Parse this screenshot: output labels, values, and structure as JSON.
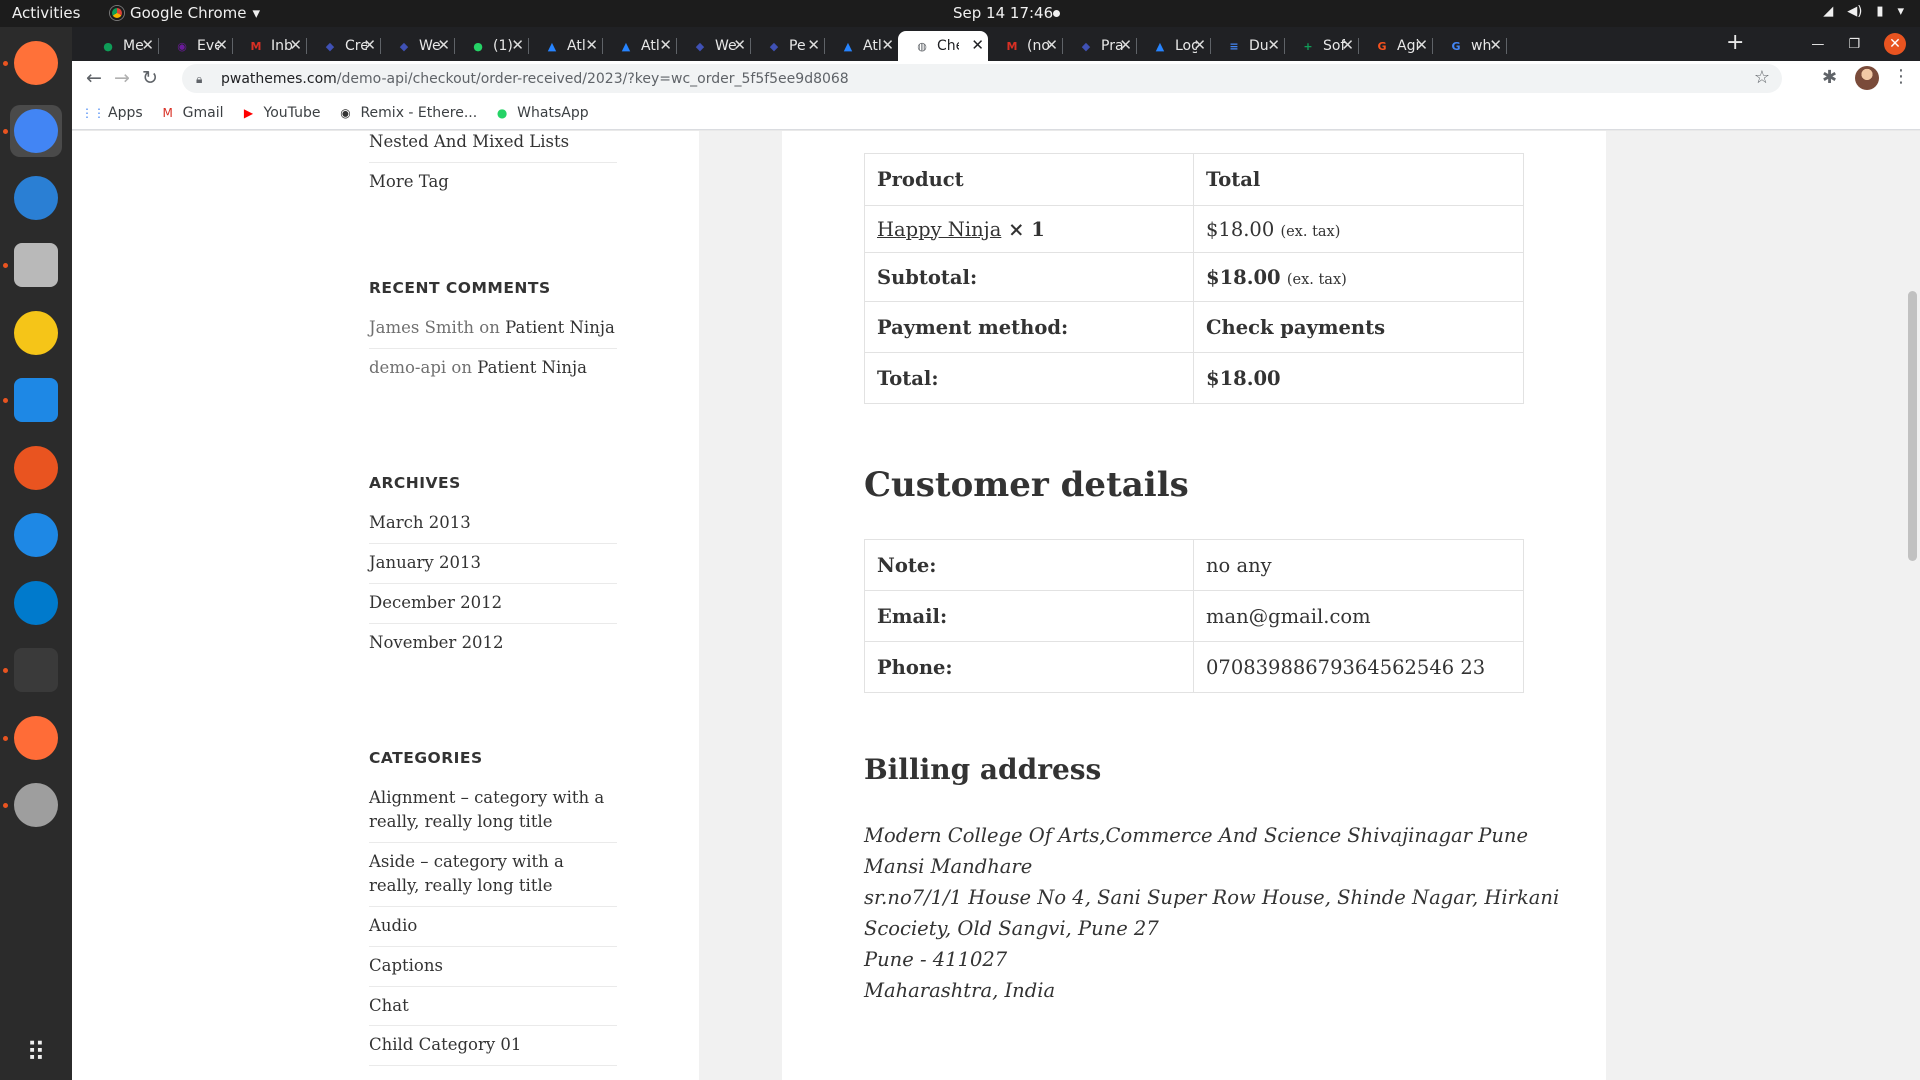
{
  "topbar": {
    "activities": "Activities",
    "app_name": "Google Chrome",
    "clock": "Sep 14  17:46"
  },
  "dock": {
    "items": [
      {
        "name": "firefox-icon",
        "color": "#ff7139"
      },
      {
        "name": "chrome-icon",
        "color": "#4285f4"
      },
      {
        "name": "thunderbird-icon",
        "color": "#2a7fd4"
      },
      {
        "name": "files-icon",
        "color": "#b9b9b9"
      },
      {
        "name": "rhythmbox-icon",
        "color": "#f5c518"
      },
      {
        "name": "writer-icon",
        "color": "#1e88e5"
      },
      {
        "name": "software-center-icon",
        "color": "#e95420"
      },
      {
        "name": "help-icon",
        "color": "#1e88e5"
      },
      {
        "name": "vscode-icon",
        "color": "#007acc"
      },
      {
        "name": "terminal-icon",
        "color": "#3a3a3a"
      },
      {
        "name": "postman-icon",
        "color": "#ff6c37"
      },
      {
        "name": "magnifier-icon",
        "color": "#9e9e9e"
      }
    ]
  },
  "tabs": [
    {
      "title": "Me",
      "fav": "#0f9d58",
      "glyph": "●"
    },
    {
      "title": "Eve",
      "fav": "#6a1b9a",
      "glyph": "◉"
    },
    {
      "title": "Inb",
      "fav": "#d93025",
      "glyph": "M"
    },
    {
      "title": "Cre",
      "fav": "#3f51b5",
      "glyph": "◆"
    },
    {
      "title": "We",
      "fav": "#3f51b5",
      "glyph": "◆"
    },
    {
      "title": "(1)",
      "fav": "#25d366",
      "glyph": "●"
    },
    {
      "title": "Atl",
      "fav": "#2684ff",
      "glyph": "▲"
    },
    {
      "title": "Atl",
      "fav": "#2684ff",
      "glyph": "▲"
    },
    {
      "title": "We",
      "fav": "#3f51b5",
      "glyph": "◆"
    },
    {
      "title": "Pe",
      "fav": "#3f51b5",
      "glyph": "◆"
    },
    {
      "title": "Atl",
      "fav": "#2684ff",
      "glyph": "▲"
    },
    {
      "title": "Che",
      "fav": "#5f6368",
      "glyph": "◍",
      "active": true
    },
    {
      "title": "(no",
      "fav": "#d93025",
      "glyph": "M"
    },
    {
      "title": "Pra",
      "fav": "#3f51b5",
      "glyph": "◆"
    },
    {
      "title": "Log",
      "fav": "#2684ff",
      "glyph": "▲"
    },
    {
      "title": "Du",
      "fav": "#4285f4",
      "glyph": "≡"
    },
    {
      "title": "Sof",
      "fav": "#0f9d58",
      "glyph": "+"
    },
    {
      "title": "Agi",
      "fav": "#f4511e",
      "glyph": "G"
    },
    {
      "title": "wh",
      "fav": "#4285f4",
      "glyph": "G"
    }
  ],
  "address": {
    "host": "pwathemes.com",
    "path": "/demo-api/checkout/order-received/2023/?key=wc_order_5f5f5ee9d8068"
  },
  "bookmarks": [
    {
      "label": "Apps",
      "icon": "apps-grid-icon"
    },
    {
      "label": "Gmail",
      "icon": "gmail-icon"
    },
    {
      "label": "YouTube",
      "icon": "youtube-icon"
    },
    {
      "label": "Remix - Ethere...",
      "icon": "remix-icon"
    },
    {
      "label": "WhatsApp",
      "icon": "whatsapp-icon"
    }
  ],
  "sidebar": {
    "top_links": [
      "Nested And Mixed Lists",
      "More Tag"
    ],
    "recent_comments": {
      "title": "RECENT COMMENTS",
      "items": [
        {
          "author": "James Smith",
          "on": " on ",
          "post": "Patient Ninja"
        },
        {
          "author": "demo-api",
          "on": " on ",
          "post": "Patient Ninja"
        }
      ]
    },
    "archives": {
      "title": "ARCHIVES",
      "items": [
        "March 2013",
        "January 2013",
        "December 2012",
        "November 2012"
      ]
    },
    "categories": {
      "title": "CATEGORIES",
      "items": [
        "Alignment – category with a really, really long title",
        "Aside – category with a really, really long title",
        "Audio",
        "Captions",
        "Chat",
        "Child Category 01"
      ]
    }
  },
  "order": {
    "head_product": "Product",
    "head_total": "Total",
    "product_name": "Happy Ninja",
    "product_qty": " × 1",
    "product_total": "$18.00",
    "tax_note": "(ex. tax)",
    "subtotal_label": "Subtotal:",
    "subtotal_value": "$18.00",
    "payment_label": "Payment method:",
    "payment_value": "Check payments",
    "total_label": "Total:",
    "total_value": "$18.00"
  },
  "customer": {
    "title": "Customer details",
    "note_label": "Note:",
    "note_value": "no any",
    "email_label": "Email:",
    "email_value": "man@gmail.com",
    "phone_label": "Phone:",
    "phone_value": "07083988679364562546 23"
  },
  "billing": {
    "title": "Billing address",
    "lines": [
      "Modern College Of Arts,Commerce And Science Shivajinagar Pune",
      "Mansi Mandhare",
      "sr.no7/1/1 House No 4, Sani Super Row House, Shinde Nagar, Hirkani",
      "Scociety, Old Sangvi, Pune 27",
      "Pune - 411027",
      "Maharashtra, India"
    ]
  }
}
